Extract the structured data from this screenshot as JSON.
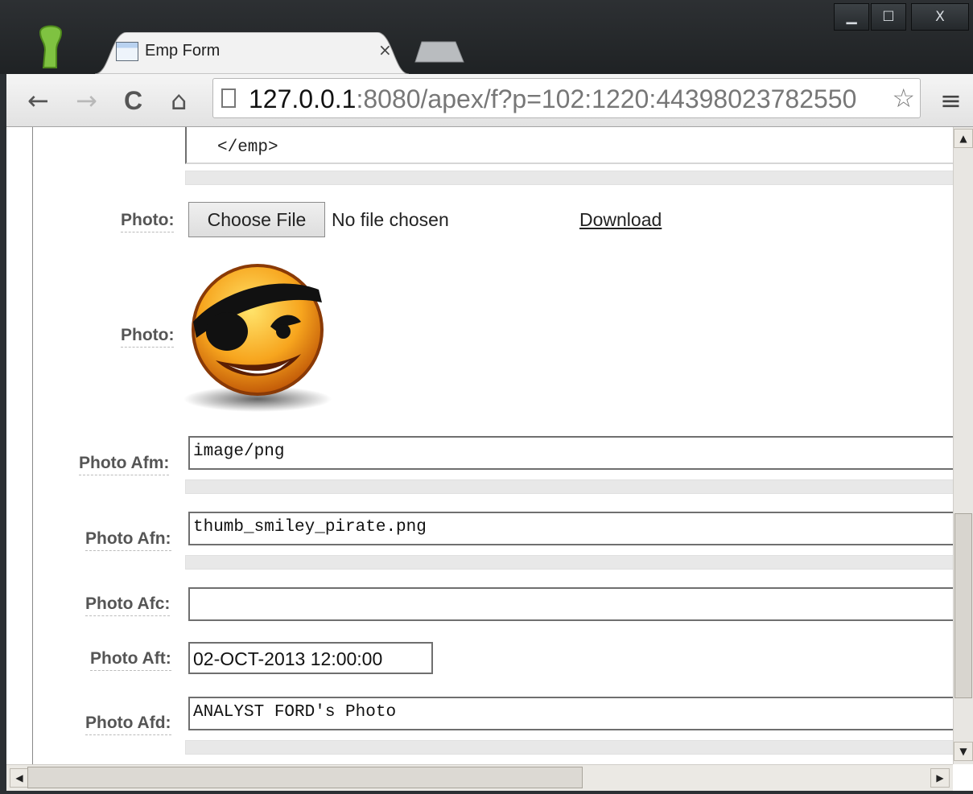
{
  "window": {
    "controls": {
      "minimize": "▁",
      "maximize": "☐",
      "close": "X"
    }
  },
  "tab": {
    "title": "Emp Form",
    "close": "×"
  },
  "toolbar": {
    "back": "←",
    "forward": "→",
    "reload": "C",
    "home": "⌂",
    "url_host": "127.0.0.1",
    "url_rest": ":8080/apex/f?p=102:1220:44398023782550",
    "menu": "≡"
  },
  "form": {
    "xml_tail": "</emp>",
    "photo_upload": {
      "label": "Photo:",
      "button": "Choose File",
      "status": "No file chosen",
      "download": "Download"
    },
    "photo_image": {
      "label": "Photo:"
    },
    "photo_afm": {
      "label": "Photo Afm:",
      "value": "image/png"
    },
    "photo_afn": {
      "label": "Photo Afn:",
      "value": "thumb_smiley_pirate.png"
    },
    "photo_afc": {
      "label": "Photo Afc:",
      "value": ""
    },
    "photo_aft": {
      "label": "Photo Aft:",
      "value": "02-OCT-2013 12:00:00"
    },
    "photo_afd": {
      "label": "Photo Afd:",
      "value": "ANALYST FORD's Photo"
    }
  },
  "scrollbars": {
    "up": "▲",
    "down": "▼",
    "left": "◀",
    "right": "▶"
  }
}
